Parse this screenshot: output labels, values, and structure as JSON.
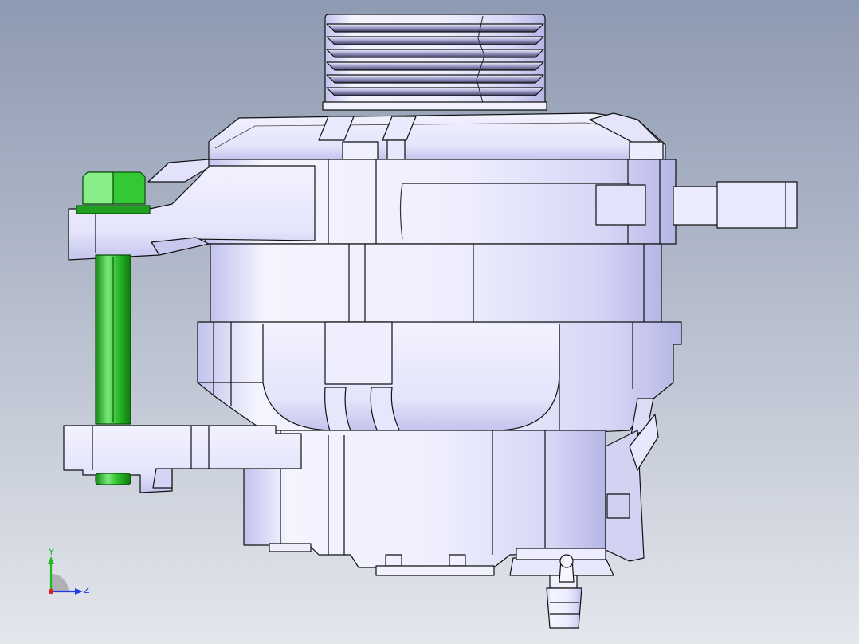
{
  "viewport": {
    "background_top": "#8e9ab2",
    "background_bottom": "#dfe3e9",
    "part_color": "#e6e6fb",
    "part_shade": "#b9b9e6",
    "edge_color": "#111111",
    "bolt_color": "#2fc42f",
    "bolt_dark": "#128a12",
    "bolt_light": "#8fee8f"
  },
  "triad": {
    "y_label": "Y",
    "z_label": "Z",
    "y_color": "#1fb81f",
    "z_color": "#1f3ce0",
    "x_color": "#e02020"
  }
}
